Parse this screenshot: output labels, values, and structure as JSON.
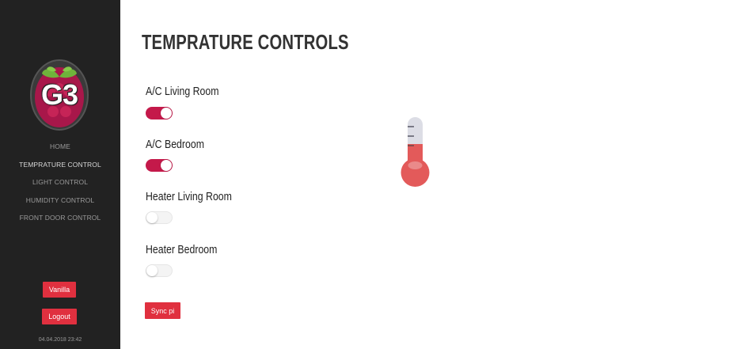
{
  "sidebar": {
    "logo_text": "G3",
    "nav": [
      {
        "label": "HOME",
        "active": false
      },
      {
        "label": "TEMPRATURE CONTROL",
        "active": true
      },
      {
        "label": "LIGHT CONTROL",
        "active": false
      },
      {
        "label": "HUMIDITY CONTROL",
        "active": false
      },
      {
        "label": "FRONT DOOR CONTROL",
        "active": false
      }
    ],
    "vanilla_label": "Vanilla",
    "logout_label": "Logout",
    "timestamp": "04.04.2018 23:42"
  },
  "main": {
    "title": "TEMPRATURE CONTROLS",
    "controls": [
      {
        "label": "A/C Living Room",
        "on": true
      },
      {
        "label": "A/C Bedroom",
        "on": true
      },
      {
        "label": "Heater Living Room",
        "on": false
      },
      {
        "label": "Heater Bedroom",
        "on": false
      }
    ],
    "sync_label": "Sync pi"
  },
  "colors": {
    "sidebar_bg": "#222222",
    "accent_red": "#e0303f",
    "toggle_on": "#c4194a",
    "thermometer_fill": "#e35a5a"
  },
  "icons": {
    "logo": "raspberry-pi-logo",
    "thermometer": "thermometer-icon"
  }
}
